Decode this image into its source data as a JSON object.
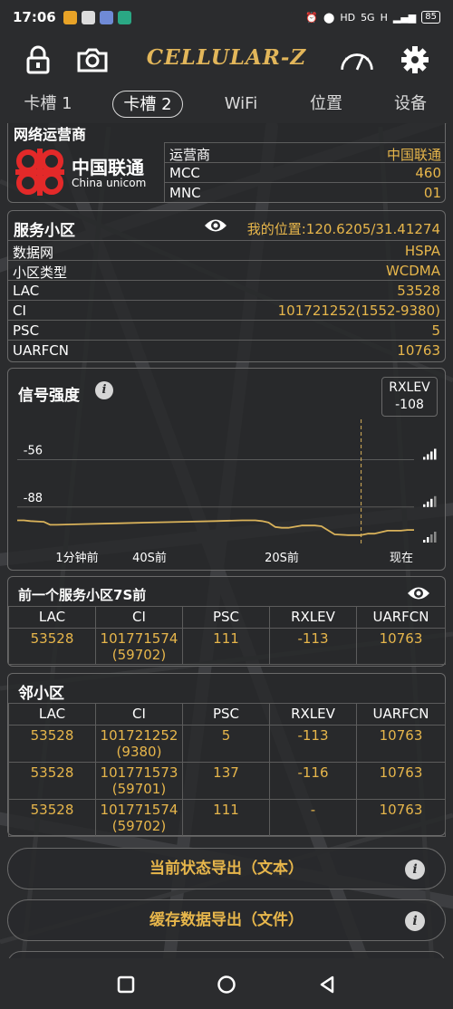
{
  "statusbar": {
    "time": "17:06",
    "network_1": "HD",
    "network_2": "5G",
    "network_3": "H",
    "battery": "85"
  },
  "app": {
    "title": "CELLULAR-Z",
    "accent_color": "#e7b64b"
  },
  "tabs": [
    {
      "label": "卡槽 1"
    },
    {
      "label": "卡槽 2"
    },
    {
      "label": "WiFi"
    },
    {
      "label": "位置"
    },
    {
      "label": "设备"
    }
  ],
  "operator": {
    "section_title": "网络运营商",
    "logo_cn": "中国联通",
    "logo_en": "China unicom",
    "rows": [
      {
        "label": "运营商",
        "value": "中国联通"
      },
      {
        "label": "MCC",
        "value": "460"
      },
      {
        "label": "MNC",
        "value": "01"
      }
    ]
  },
  "serving_cell": {
    "title": "服务小区",
    "location": "我的位置:120.6205/31.41274",
    "rows": [
      {
        "label": "数据网",
        "value": "HSPA"
      },
      {
        "label": "小区类型",
        "value": "WCDMA"
      },
      {
        "label": "LAC",
        "value": "53528"
      },
      {
        "label": "CI",
        "value": "101721252(1552-9380)"
      },
      {
        "label": "PSC",
        "value": "5"
      },
      {
        "label": "UARFCN",
        "value": "10763"
      }
    ]
  },
  "signal": {
    "title": "信号强度",
    "badge_label": "RXLEV",
    "badge_value": "-108"
  },
  "chart_data": {
    "type": "line",
    "title": "信号强度",
    "y_ticks": [
      "-56",
      "-88"
    ],
    "x_ticks": [
      "1分钟前",
      "40S前",
      "20S前",
      "现在"
    ],
    "series": [
      {
        "x_seconds_ago": [
          60,
          59,
          58,
          56,
          55,
          54,
          50,
          45,
          40,
          35,
          30,
          26,
          24,
          23,
          22,
          21,
          20,
          19,
          17,
          16,
          15,
          14,
          12,
          10,
          8,
          7,
          6,
          4,
          2,
          1,
          0
        ],
        "values": [
          -97,
          -97,
          -97.5,
          -98,
          -100,
          -100,
          -99.5,
          -99,
          -98.5,
          -98,
          -97.5,
          -97,
          -97,
          -97.5,
          -98.5,
          -101.5,
          -102,
          -102,
          -100.5,
          -100.5,
          -100.5,
          -101,
          -106.5,
          -107,
          -107,
          -106,
          -106,
          -104,
          -104,
          -103.5,
          -103.5
        ]
      }
    ],
    "marker_seconds_ago": 8,
    "ylim": [
      -112,
      -30
    ],
    "line_color": "#d9b25a"
  },
  "previous_cell": {
    "title": "前一个服务小区7S前",
    "headers": [
      "LAC",
      "CI",
      "PSC",
      "RXLEV",
      "UARFCN"
    ],
    "rows": [
      {
        "lac": "53528",
        "ci": "101771574",
        "ci2": "(59702)",
        "psc": "111",
        "rxlev": "-113",
        "uarfcn": "10763"
      }
    ]
  },
  "neighbors": {
    "title": "邻小区",
    "headers": [
      "LAC",
      "CI",
      "PSC",
      "RXLEV",
      "UARFCN"
    ],
    "rows": [
      {
        "lac": "53528",
        "ci": "101721252",
        "ci2": "(9380)",
        "psc": "5",
        "rxlev": "-113",
        "uarfcn": "10763"
      },
      {
        "lac": "53528",
        "ci": "101771573",
        "ci2": "(59701)",
        "psc": "137",
        "rxlev": "-116",
        "uarfcn": "10763"
      },
      {
        "lac": "53528",
        "ci": "101771574",
        "ci2": "(59702)",
        "psc": "111",
        "rxlev": "-",
        "uarfcn": "10763"
      }
    ]
  },
  "actions": {
    "export_text": "当前状态导出（文本）",
    "export_file": "缓存数据导出（文件）"
  }
}
